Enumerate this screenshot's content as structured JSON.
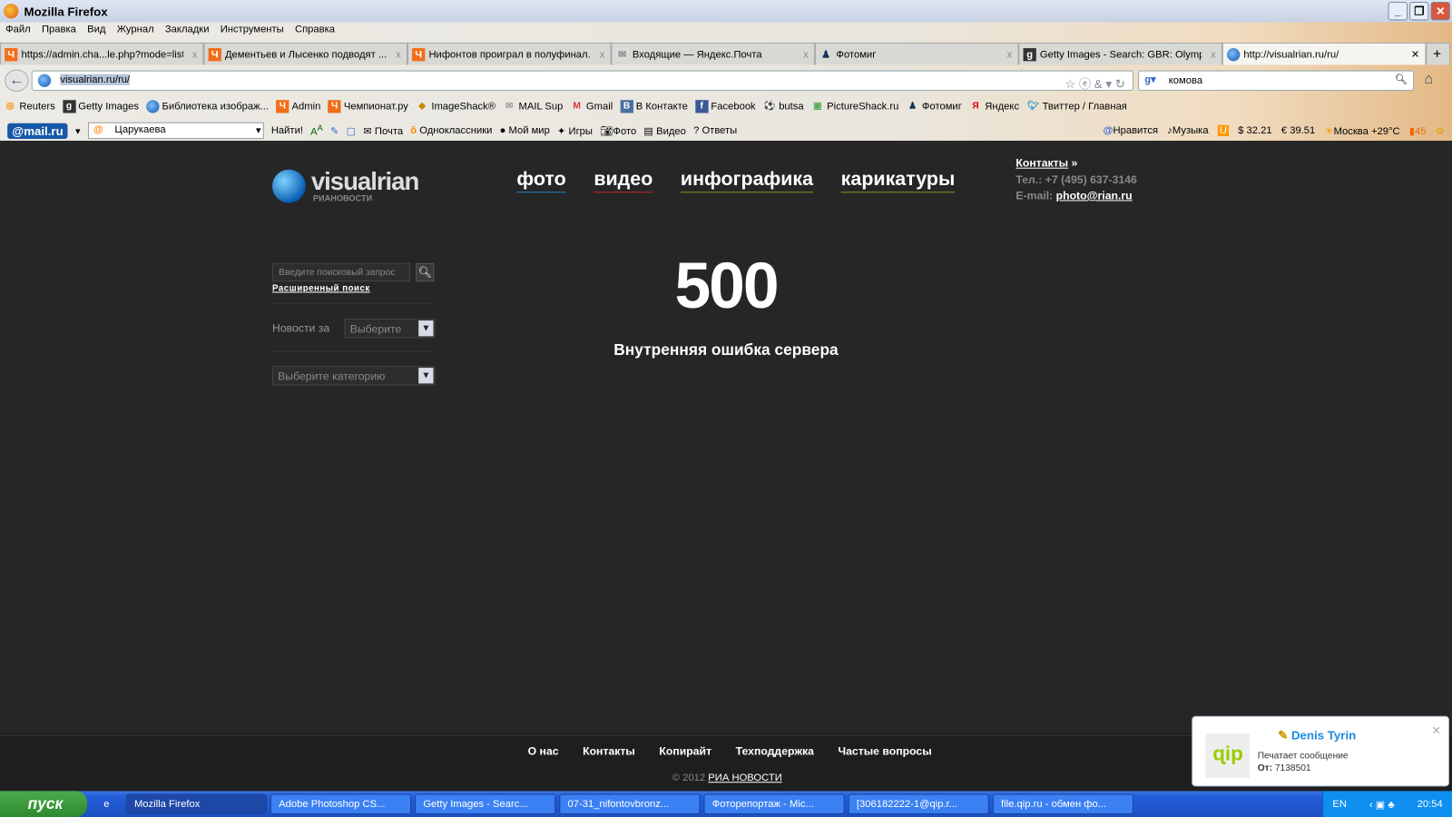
{
  "window": {
    "title": "Mozilla Firefox"
  },
  "menu": [
    "Файл",
    "Правка",
    "Вид",
    "Журнал",
    "Закладки",
    "Инструменты",
    "Справка"
  ],
  "tabs": [
    {
      "label": "https://admin.cha...le.php?mode=list",
      "icon": "championat-icon"
    },
    {
      "label": "Дементьев и Лысенко подводят ...",
      "icon": "championat-icon"
    },
    {
      "label": "Нифонтов проиграл в полуфинал...",
      "icon": "championat-icon"
    },
    {
      "label": "Входящие — Яндекс.Почта",
      "icon": "mail-icon"
    },
    {
      "label": "Фотомиг",
      "icon": "user-icon"
    },
    {
      "label": "Getty Images - Search: GBR: Olymp...",
      "icon": "getty-icon"
    },
    {
      "label": "http://visualrian.ru/ru/",
      "icon": "globe-icon",
      "active": true
    }
  ],
  "address": {
    "url": "visualrian.ru/ru/"
  },
  "search": {
    "value": "комова"
  },
  "bookmarks": [
    "Reuters",
    "Getty Images",
    "Библиотека изображ...",
    "Admin",
    "Чемпионат.ру",
    "ImageShack®",
    "MAIL Sup",
    "Gmail",
    "В Контакте",
    "Facebook",
    "butsa",
    "PictureShack.ru",
    "Фотомиг",
    "Яндекс",
    "Твиттер / Главная"
  ],
  "mailbar": {
    "logo": "@mail.ru",
    "query": "Царукаева",
    "find": "Найти!",
    "links": [
      "Почта",
      "Одноклассники",
      "Мой мир",
      "Игры",
      "Фото",
      "Видео",
      "Ответы"
    ],
    "right": [
      "Нравится",
      "Музыка",
      "$ 32.21",
      "€ 39.51",
      "Москва +29°C",
      "45"
    ]
  },
  "site": {
    "logo": {
      "name": "visualrian",
      "sub": "РИАНОВОСТИ"
    },
    "nav": [
      {
        "label": "фото",
        "color": "#1e7fc0"
      },
      {
        "label": "видео",
        "color": "#c0282e"
      },
      {
        "label": "инфографика",
        "color": "#7a9a1e"
      },
      {
        "label": "карикатуры",
        "color": "#7a9a1e"
      }
    ],
    "contacts": {
      "link": "Контакты",
      "arrow": " »",
      "phone": "Тел.: +7 (495) 637-3146",
      "email_label": "E-mail: ",
      "email": "photo@rian.ru"
    },
    "sidebar": {
      "search_placeholder": "Введите поисковый запрос",
      "advanced": "Расширенный поиск",
      "news_label": "Новости за",
      "period": "Выберите",
      "category": "Выберите категорию"
    },
    "error": {
      "code": "500",
      "message": "Внутренняя ошибка сервера"
    },
    "footer": {
      "links": [
        "О нас",
        "Контакты",
        "Копирайт",
        "Техподдержка",
        "Частые вопросы"
      ],
      "copyright": "© 2012 ",
      "brand": "РИА НОВОСТИ"
    }
  },
  "notification": {
    "name": "Denis Tyrin",
    "text": "Печатает сообщение",
    "from_label": "От: ",
    "from": "7138501",
    "icon_text": "qip"
  },
  "taskbar": {
    "start": "пуск",
    "tasks": [
      "Mozilla Firefox",
      "Adobe Photoshop CS...",
      "Getty Images - Searc...",
      "07-31_nifontovbronz...",
      "Фоторепортаж - Mic...",
      "[306182222-1@qip.r...",
      "file.qip.ru - обмен фо..."
    ],
    "lang": "EN",
    "clock": "20:54"
  }
}
